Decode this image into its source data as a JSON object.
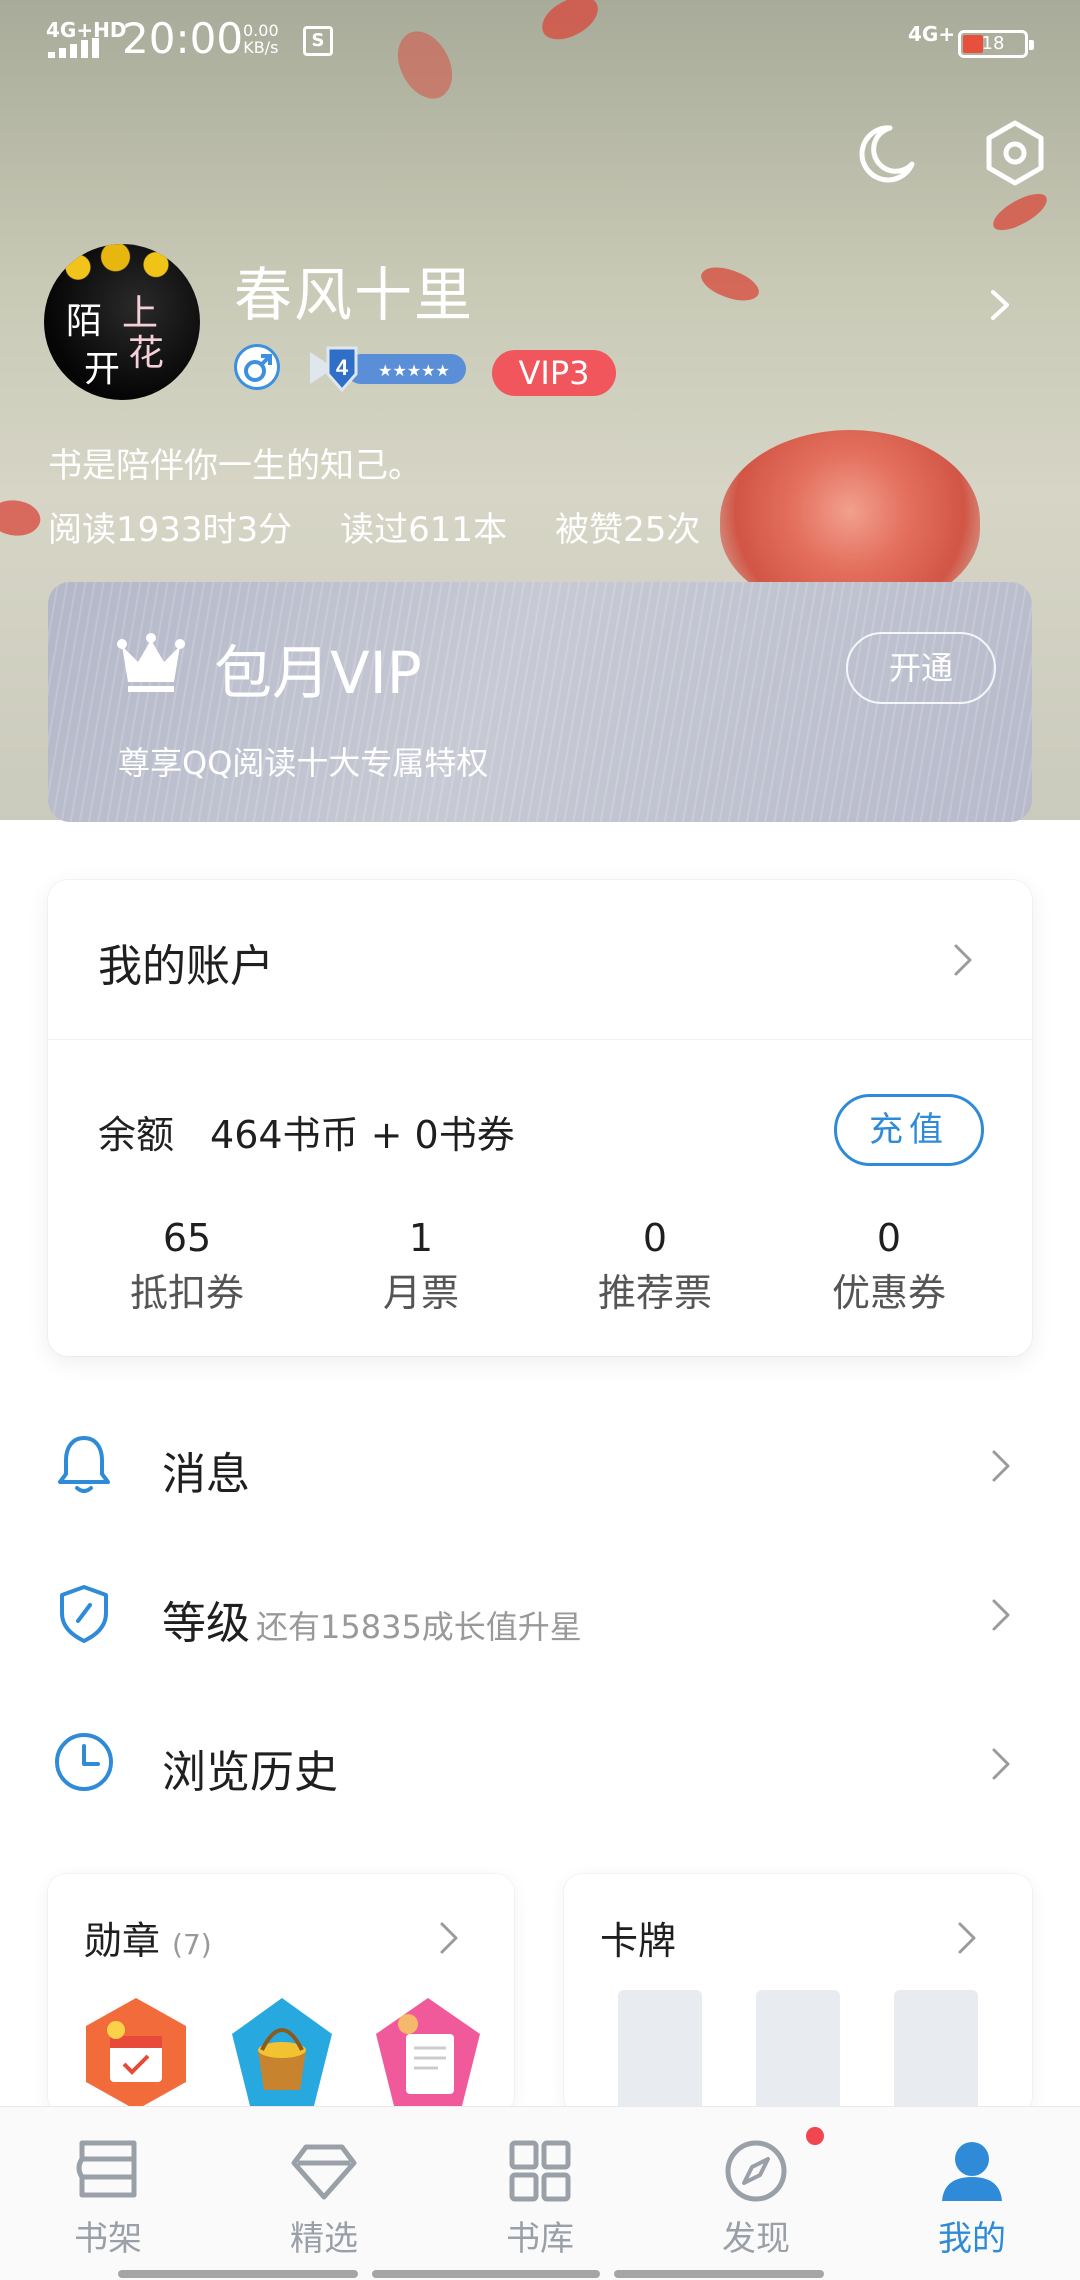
{
  "status_bar": {
    "network_left": "4G+HD",
    "time": "20:00",
    "speed_value": "0.00",
    "speed_unit": "KB/s",
    "network_right": "4G+",
    "battery": "18"
  },
  "profile": {
    "name": "春风十里",
    "vip_level": "VIP3",
    "user_level": "4",
    "bio": "书是陪伴你一生的知己。",
    "stats": [
      "阅读1933时3分",
      "读过611本",
      "被赞25次"
    ]
  },
  "vip_card": {
    "title": "包月VIP",
    "subtitle": "尊享QQ阅读十大专属特权",
    "button": "开通"
  },
  "account": {
    "title": "我的账户",
    "balance_label": "余额",
    "balance_value": "464书币 + 0书券",
    "recharge": "充值",
    "tickets": [
      {
        "value": "65",
        "label": "抵扣券"
      },
      {
        "value": "1",
        "label": "月票"
      },
      {
        "value": "0",
        "label": "推荐票"
      },
      {
        "value": "0",
        "label": "优惠券"
      }
    ]
  },
  "menu": {
    "messages": "消息",
    "level": "等级",
    "level_hint": "还有15835成长值升星",
    "history": "浏览历史"
  },
  "medals": {
    "title": "勋章",
    "count": "(7)"
  },
  "cards": {
    "title": "卡牌"
  },
  "nav": [
    {
      "label": "书架",
      "icon": "bookshelf-icon"
    },
    {
      "label": "精选",
      "icon": "diamond-icon"
    },
    {
      "label": "书库",
      "icon": "grid-icon"
    },
    {
      "label": "发现",
      "icon": "compass-icon"
    },
    {
      "label": "我的",
      "icon": "person-icon"
    }
  ],
  "colors": {
    "accent": "#2f8bd8",
    "vip_badge": "#f0565c",
    "notification_dot": "#f0464f"
  }
}
